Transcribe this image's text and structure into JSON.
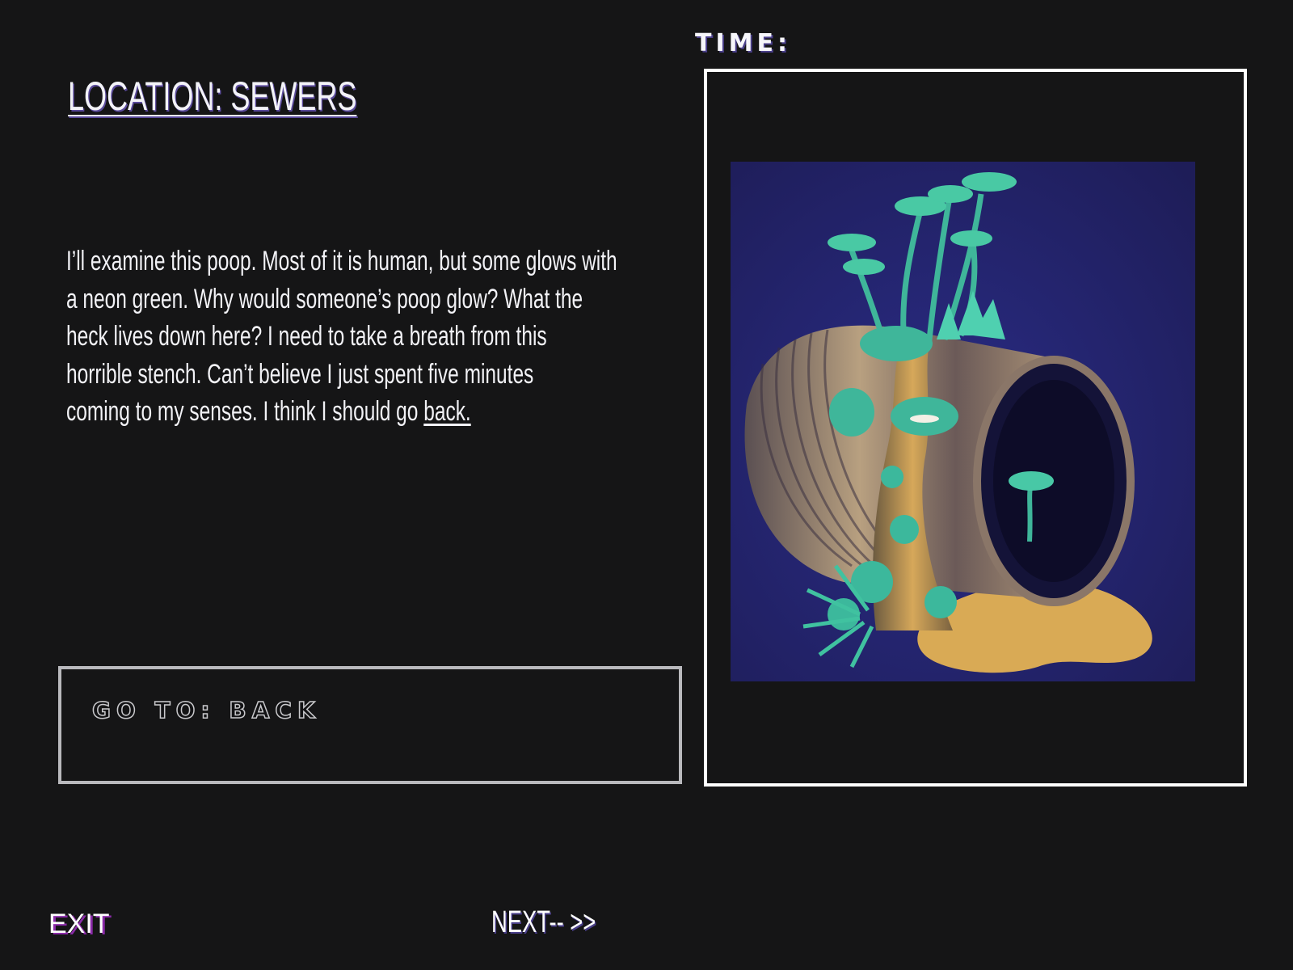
{
  "header": {
    "location_title": "LOCATION: SEWERS",
    "time_label": "TIME:"
  },
  "narrative": {
    "lines": [
      "I’ll examine this poop. Most of it is human, but some glows with",
      " a neon green. Why would someone’s poop glow? What the",
      "heck lives down here? I need to take a breath from this",
      "horrible stench. Can’t believe I just spent five minutes",
      "coming to my senses. I think I should go "
    ],
    "link_text": "back."
  },
  "goto": {
    "label": "GO TO: BACK"
  },
  "scene_image": {
    "subject": "tin-can-mushroom-sculpture",
    "colors": {
      "backdrop": "#34307a",
      "fungus": "#3fc1a0",
      "can": "#8a7a6a",
      "slime": "#d8a850"
    }
  },
  "footer": {
    "exit_label": "EXIT",
    "next_label": "NEXT-- >>"
  },
  "colors": {
    "background": "#151516",
    "text": "#f2f2f6",
    "title_shadow": "#5a4a9a",
    "exit_shadow": "#8a2aa8",
    "goto_border": "#b9b9bd",
    "frame_border": "#ffffff"
  }
}
